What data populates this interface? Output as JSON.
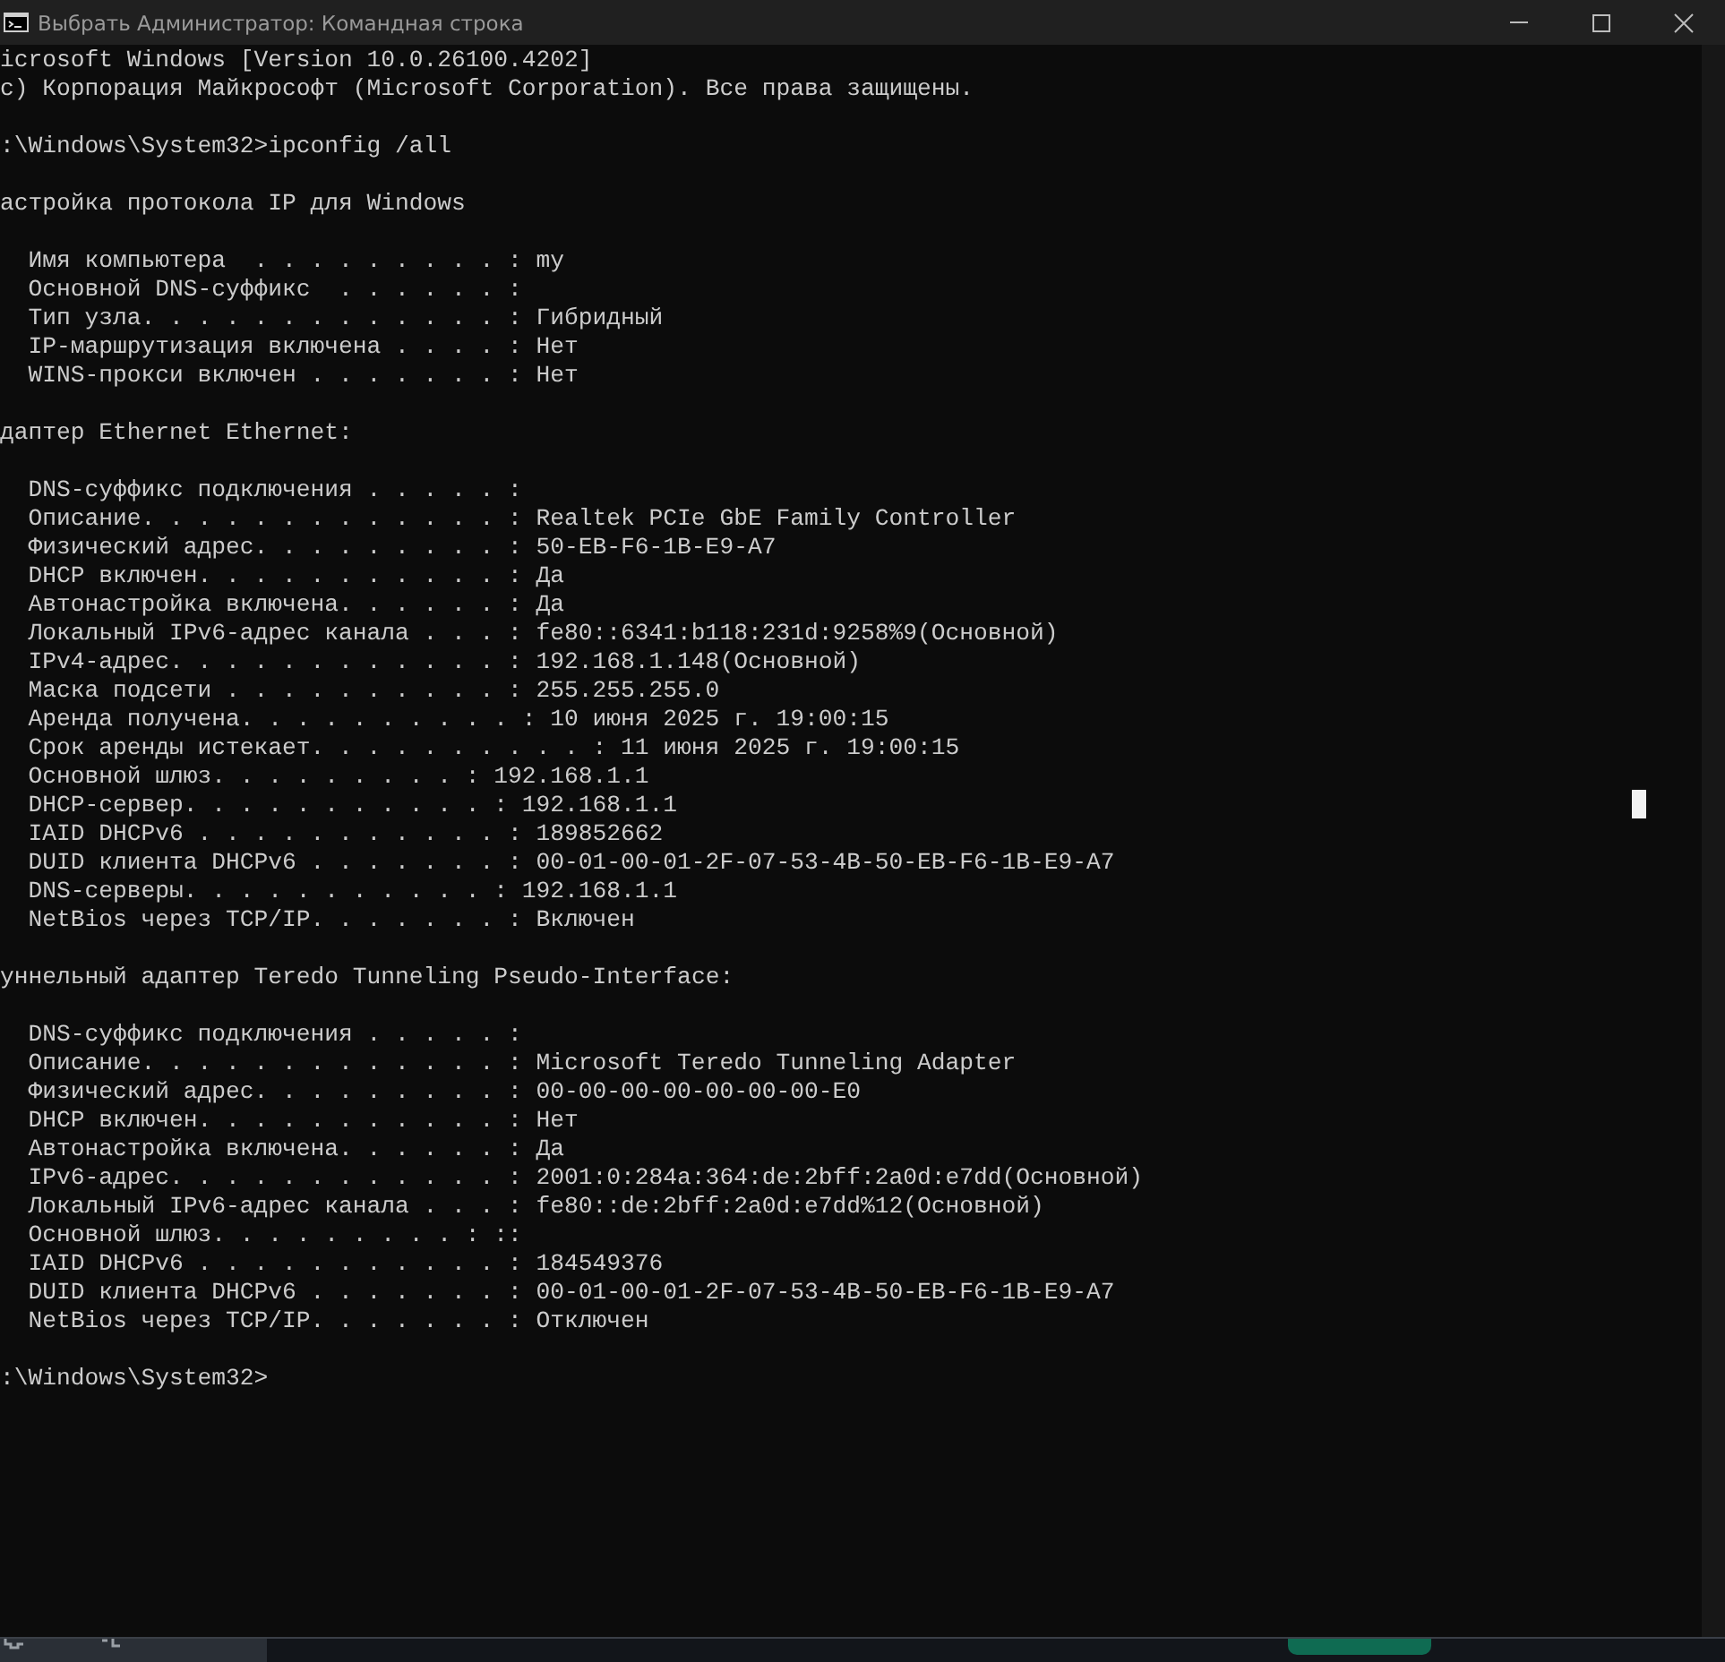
{
  "window": {
    "title": "Выбрать Администратор: Командная строка"
  },
  "console": {
    "blocks": [
      {
        "kind": "text",
        "lines": [
          "icrosoft Windows [Version 10.0.26100.4202]",
          "c) Корпорация Майкрософт (Microsoft Corporation). Все права защищены."
        ]
      },
      {
        "kind": "text",
        "lines": [
          ":\\Windows\\System32>ipconfig /all"
        ]
      },
      {
        "kind": "text",
        "lines": [
          "астройка протокола IP для Windows"
        ]
      },
      {
        "kind": "entries",
        "lines": [
          "Имя компьютера  . . . . . . . . . : my",
          "Основной DNS-суффикс  . . . . . . :",
          "Тип узла. . . . . . . . . . . . . : Гибридный",
          "IP-маршрутизация включена . . . . : Нет",
          "WINS-прокси включен . . . . . . . : Нет"
        ]
      },
      {
        "kind": "text",
        "lines": [
          "даптер Ethernet Ethernet:"
        ]
      },
      {
        "kind": "entries",
        "lines": [
          "DNS-суффикс подключения . . . . . :",
          "Описание. . . . . . . . . . . . . : Realtek PCIe GbE Family Controller",
          "Физический адрес. . . . . . . . . : 50-EB-F6-1B-E9-A7",
          "DHCP включен. . . . . . . . . . . : Да",
          "Автонастройка включена. . . . . . : Да",
          "Локальный IPv6-адрес канала . . . : fe80::6341:b118:231d:9258%9(Основной)",
          "IPv4-адрес. . . . . . . . . . . . : 192.168.1.148(Основной)",
          "Маска подсети . . . . . . . . . . : 255.255.255.0",
          "Аренда получена. . . . . . . . . . : 10 июня 2025 г. 19:00:15",
          "Срок аренды истекает. . . . . . . . . . : 11 июня 2025 г. 19:00:15",
          "Основной шлюз. . . . . . . . . : 192.168.1.1",
          "DHCP-сервер. . . . . . . . . . . : 192.168.1.1",
          "IAID DHCPv6 . . . . . . . . . . . : 189852662",
          "DUID клиента DHCPv6 . . . . . . . : 00-01-00-01-2F-07-53-4B-50-EB-F6-1B-E9-A7",
          "DNS-серверы. . . . . . . . . . . : 192.168.1.1",
          "NetBios через TCP/IP. . . . . . . : Включен"
        ]
      },
      {
        "kind": "text",
        "lines": [
          "уннельный адаптер Teredo Tunneling Pseudo-Interface:"
        ]
      },
      {
        "kind": "entries",
        "lines": [
          "DNS-суффикс подключения . . . . . :",
          "Описание. . . . . . . . . . . . . : Microsoft Teredo Tunneling Adapter",
          "Физический адрес. . . . . . . . . : 00-00-00-00-00-00-00-E0",
          "DHCP включен. . . . . . . . . . . : Нет",
          "Автонастройка включена. . . . . . : Да",
          "IPv6-адрес. . . . . . . . . . . . : 2001:0:284a:364:de:2bff:2a0d:e7dd(Основной)",
          "Локальный IPv6-адрес канала . . . : fe80::de:2bff:2a0d:e7dd%12(Основной)",
          "Основной шлюз. . . . . . . . . : ::",
          "IAID DHCPv6 . . . . . . . . . . . : 184549376",
          "DUID клиента DHCPv6 . . . . . . . : 00-01-00-01-2F-07-53-4B-50-EB-F6-1B-E9-A7",
          "NetBios через TCP/IP. . . . . . . : Отключен"
        ]
      },
      {
        "kind": "text",
        "lines": [
          ":\\Windows\\System32>"
        ]
      }
    ]
  }
}
